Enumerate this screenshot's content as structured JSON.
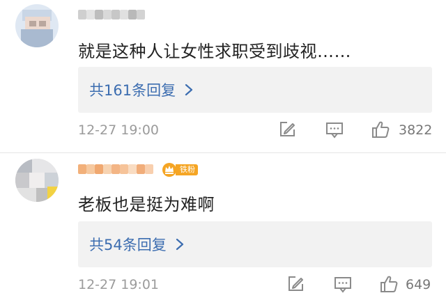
{
  "comments": [
    {
      "text": "就是这种人让女性求职受到歧视……",
      "reply_label": "共161条回复",
      "timestamp": "12-27 19:00",
      "like_count": "3822",
      "has_fan_badge": false
    },
    {
      "text": "老板也是挺为难啊",
      "reply_label": "共54条回复",
      "timestamp": "12-27 19:01",
      "like_count": "649",
      "fan_badge_label": "铁粉",
      "has_fan_badge": true
    }
  ],
  "colors": {
    "link": "#3c6db0",
    "meta_text": "#9b9b9b",
    "reply_bg": "#f2f2f2",
    "badge": "#f5a524"
  },
  "icons": {
    "edit": "edit-icon",
    "message": "message-icon",
    "like": "thumbs-up-icon",
    "chevron": "chevron-right-icon",
    "fan_crown": "crown-icon"
  }
}
